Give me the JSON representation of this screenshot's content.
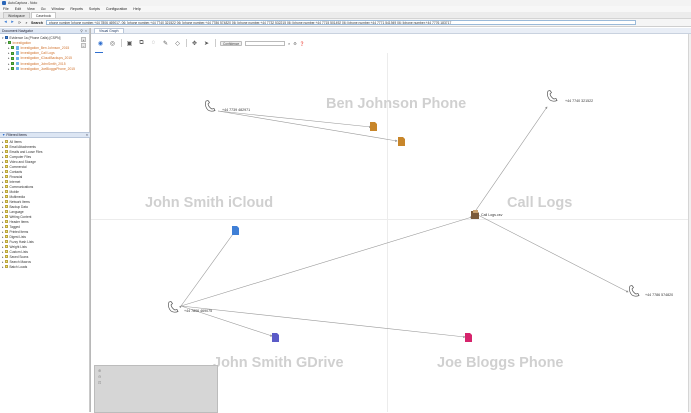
{
  "window": {
    "title": "AutoCaptura - Noto"
  },
  "menu": [
    "File",
    "Edit",
    "View",
    "Go",
    "Window",
    "Reports",
    "Scripts",
    "Configuration",
    "Help"
  ],
  "case_tabs": [
    "Workspace",
    "Casebook"
  ],
  "search": {
    "label": "Search",
    "value": "phone number [phone number,+44 7806 469017, 06: [phone number,+44 7740 321522 06: [phone number,+44 7786 574820 06: [phone number,+44 7732 532215 06: [phone number,+44 7715 501492 06: [phone number,+44 7771 541949 06: [phone number,+44 7776 183717"
  },
  "left_panel": {
    "header": "Document Navigator",
    "tree": [
      {
        "label": "Evidence 1a (Phone Calls) [CSPN]",
        "level": 0,
        "icon": "folder",
        "color": "dark"
      },
      {
        "label": "Investigation",
        "level": 1,
        "icon": "source",
        "color": "orange"
      },
      {
        "label": "Investigation_Ben Johnson_2015",
        "level": 2,
        "icon": "source",
        "color": "orange"
      },
      {
        "label": "Investigation_Call Logs",
        "level": 2,
        "icon": "source",
        "color": "orange"
      },
      {
        "label": "Investigation_iCloudBackups_2015",
        "level": 2,
        "icon": "source",
        "color": "orange"
      },
      {
        "label": "Investigation_JohnSmith_2015",
        "level": 2,
        "icon": "source",
        "color": "orange"
      },
      {
        "label": "Investigation_JoeBloggsPhone_2015",
        "level": 2,
        "icon": "source",
        "color": "orange"
      }
    ],
    "filter_header": "Filtered Items",
    "filters": [
      "All Items",
      "Email Attachments",
      "Emails and Loose Files",
      "Computer Files",
      "Video and Storage",
      "Commercial",
      "Contacts",
      "Financial",
      "Internet",
      "Communications",
      "Mobile",
      "Multimedia",
      "Network Items",
      "Backup Data",
      "Language",
      "Writing Content",
      "Header Items",
      "Tagged",
      "Printed Items",
      "Digest Lists",
      "Fuzzy Hash Lists",
      "Weight Lists",
      "Custom Lists",
      "Saved Scans",
      "Search Macros",
      "Batch Loads"
    ]
  },
  "graph": {
    "tab": "Visual Graph",
    "toolbar": {
      "select_label": "Confidence"
    },
    "watermarks": {
      "ben": "Ben Johnson Phone",
      "john_icloud": "John Smith iCloud",
      "call_logs": "Call Logs",
      "john_gdrive": "John Smith GDrive",
      "joe": "Joe Bloggs Phone"
    },
    "labels": {
      "n1": "+44 7739 482971",
      "n2": "+44 7740 321522",
      "n3": "Call Logs.csv",
      "n4": "+44 7786 574820",
      "n5": "+44 7806 469075"
    }
  },
  "colors": {
    "accent": "#2f6fcf",
    "doc_orange": "#c8862a",
    "doc_blue": "#3f7fd6",
    "doc_pink": "#d6246c",
    "doc_indigo": "#5b5bc8",
    "watermark": "#d0d0d0"
  }
}
